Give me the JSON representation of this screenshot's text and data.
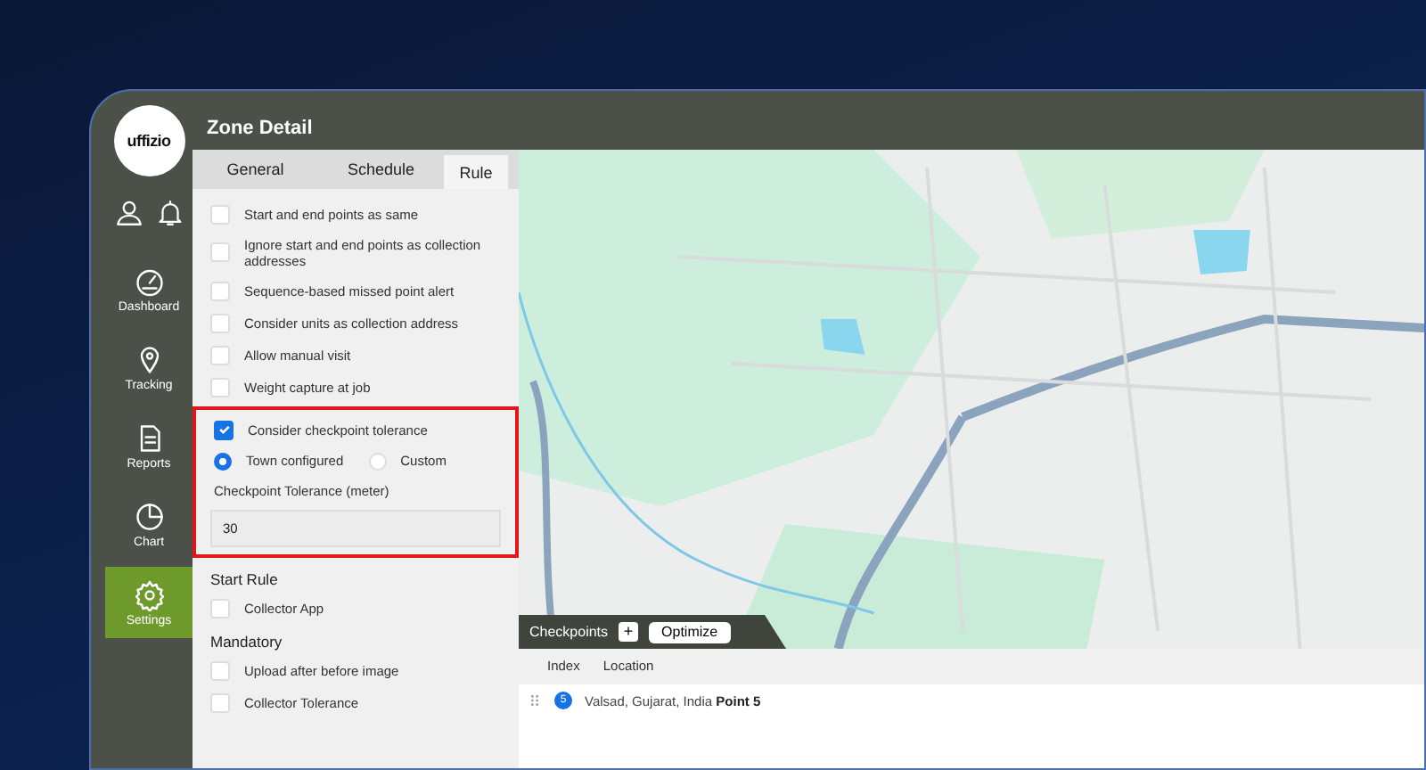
{
  "sidebar": {
    "logo": "uffizio",
    "nav": [
      {
        "kind": "dashboard",
        "label": "Dashboard",
        "selected": false
      },
      {
        "kind": "tracking",
        "label": "Tracking",
        "selected": false
      },
      {
        "kind": "reports",
        "label": "Reports",
        "selected": false
      },
      {
        "kind": "chart",
        "label": "Chart",
        "selected": false
      },
      {
        "kind": "settings",
        "label": "Settings",
        "selected": true
      }
    ]
  },
  "panel": {
    "title": "Zone Detail",
    "tabs": [
      {
        "label": "General",
        "selected": false
      },
      {
        "label": "Schedule",
        "selected": false
      },
      {
        "label": "Rule",
        "selected": true
      }
    ],
    "rules": [
      {
        "label": "Start and end points as same",
        "checked": false
      },
      {
        "label": "Ignore start and end points as collection addresses",
        "checked": false
      },
      {
        "label": "Sequence-based missed point alert",
        "checked": false
      },
      {
        "label": "Consider units as collection address",
        "checked": false
      },
      {
        "label": "Allow manual visit",
        "checked": false
      },
      {
        "label": "Weight capture at job",
        "checked": false
      }
    ],
    "tolerance": {
      "highlighted": true,
      "label": "Consider checkpoint tolerance",
      "checked": true,
      "options": [
        {
          "label": "Town configured",
          "selected": true
        },
        {
          "label": "Custom",
          "selected": false
        }
      ],
      "field_label": "Checkpoint Tolerance (meter)",
      "value": "30"
    },
    "sections": [
      {
        "title": "Start Rule",
        "items": [
          {
            "label": "Collector App",
            "checked": false
          }
        ]
      },
      {
        "title": "Mandatory",
        "items": [
          {
            "label": "Upload after before image",
            "checked": false
          },
          {
            "label": "Collector Tolerance",
            "checked": false
          }
        ]
      }
    ]
  },
  "checkpoints": {
    "title": "Checkpoints",
    "add": "+",
    "optimize": "Optimize",
    "columns": [
      "Index",
      "Location"
    ],
    "rows": [
      {
        "index": "5",
        "location": "Valsad, Gujarat, India **Point 5**"
      }
    ]
  }
}
